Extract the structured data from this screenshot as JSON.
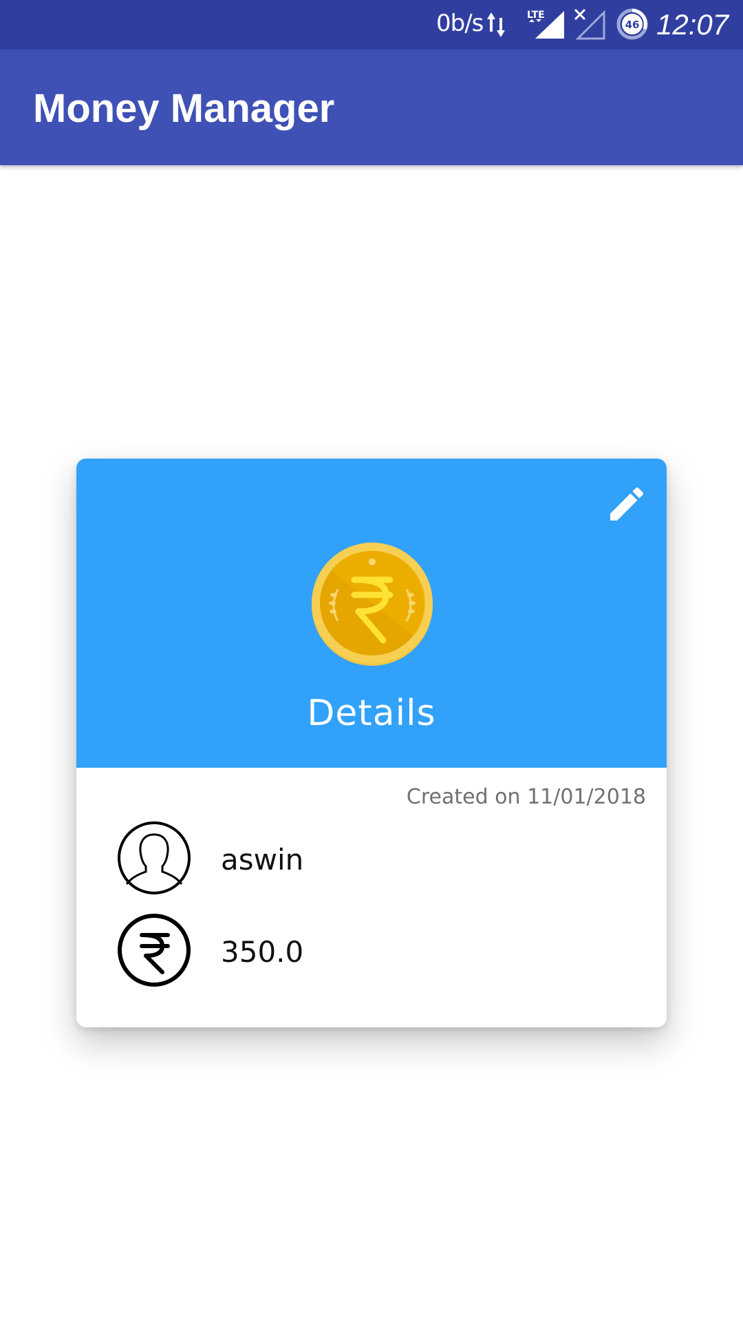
{
  "status_bar": {
    "net_speed": "0b/s",
    "time": "12:07",
    "network_label": "LTE",
    "battery_level": "46",
    "icons": [
      "data-transfer-arrows-icon",
      "lte-signal-icon",
      "no-sim-signal-icon",
      "battery-icon"
    ]
  },
  "app_bar": {
    "title": "Money Manager",
    "color": "#3f51b5"
  },
  "card": {
    "header_color": "#31a1f9",
    "title": "Details",
    "created_on": "Created on 11/01/2018",
    "edit_icon": "pencil-icon",
    "coin_icon": "rupee-coin-icon",
    "rows": [
      {
        "icon": "user-avatar-icon",
        "value": "aswin"
      },
      {
        "icon": "rupee-icon",
        "value": "350.0"
      }
    ]
  }
}
